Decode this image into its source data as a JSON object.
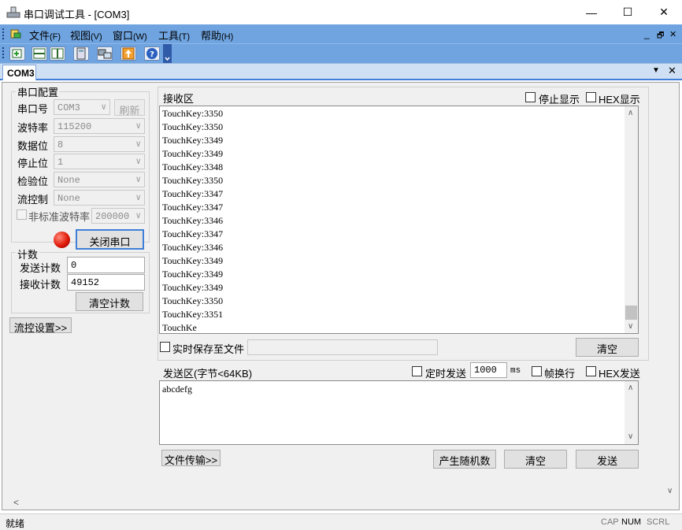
{
  "window": {
    "title": "串口调试工具 - [COM3]",
    "minimize": "—",
    "maximize": "☐",
    "close": "✕"
  },
  "menubar": {
    "items": [
      {
        "label": "文件",
        "accel": "(F)"
      },
      {
        "label": "视图",
        "accel": "(V)"
      },
      {
        "label": "窗口",
        "accel": "(W)"
      },
      {
        "label": "工具",
        "accel": "(T)"
      },
      {
        "label": "帮助",
        "accel": "(H)"
      }
    ],
    "mdi_min": "_",
    "mdi_restore": "🗗",
    "mdi_close": "✕"
  },
  "tab": {
    "label": "COM3",
    "menu": "▼",
    "close": "✕"
  },
  "serial_config": {
    "title": "串口配置",
    "port_label": "串口号",
    "port_value": "COM3",
    "refresh_label": "刷新",
    "baud_label": "波特率",
    "baud_value": "115200",
    "databits_label": "数据位",
    "databits_value": "8",
    "stopbits_label": "停止位",
    "stopbits_value": "1",
    "parity_label": "检验位",
    "parity_value": "None",
    "flow_label": "流控制",
    "flow_value": "None",
    "nonstd_label": "非标准波特率",
    "nonstd_value": "200000",
    "close_port_label": "关闭串口"
  },
  "counter": {
    "title": "计数",
    "send_label": "发送计数",
    "send_value": "0",
    "recv_label": "接收计数",
    "recv_value": "49152",
    "clear_label": "清空计数"
  },
  "flow_settings_label": "流控设置>>",
  "receive": {
    "title": "接收区",
    "stop_display_label": "停止显示",
    "hex_display_label": "HEX显示",
    "lines": [
      "TouchKey:3350",
      "TouchKey:3350",
      "TouchKey:3349",
      "TouchKey:3349",
      "TouchKey:3348",
      "TouchKey:3350",
      "TouchKey:3347",
      "TouchKey:3347",
      "TouchKey:3346",
      "TouchKey:3347",
      "TouchKey:3346",
      "TouchKey:3349",
      "TouchKey:3349",
      "TouchKey:3349",
      "TouchKey:3350",
      "TouchKey:3351",
      "TouchKe"
    ],
    "save_to_file_label": "实时保存至文件",
    "clear_label": "清空"
  },
  "send": {
    "title": "发送区(字节<64KB)",
    "timed_send_label": "定时发送",
    "interval_value": "1000",
    "interval_unit": "ms",
    "frame_newline_label": "帧换行",
    "hex_send_label": "HEX发送",
    "content": "abcdefg",
    "file_transfer_label": "文件传输>>",
    "random_label": "产生随机数",
    "clear_label": "清空",
    "send_label": "发送"
  },
  "statusbar": {
    "ready": "就绪",
    "cap": "CAP",
    "num": "NUM",
    "scrl": "SCRL"
  },
  "colors": {
    "menubar": "#6fa4e0",
    "tab_accent": "#3f7fd8",
    "led": "#e01a08"
  }
}
